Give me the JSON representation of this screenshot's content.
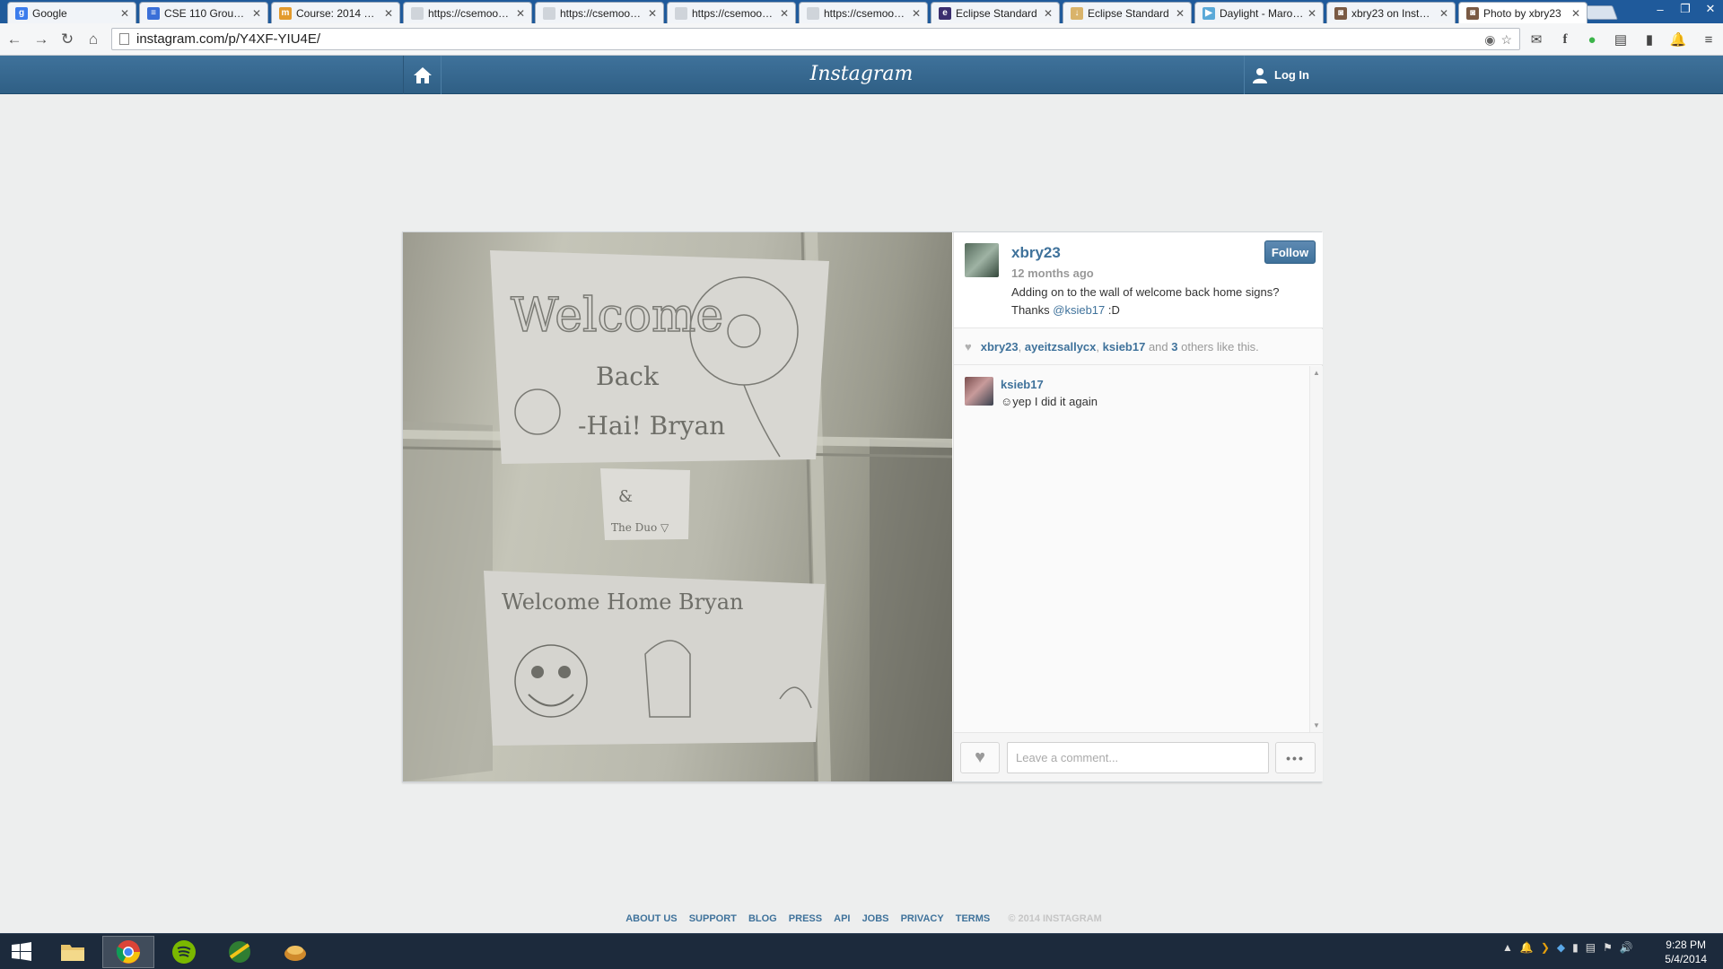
{
  "browser": {
    "tabs": [
      {
        "title": "Google",
        "icon": "google-icon",
        "color": "#3b7cec",
        "glyph": "g"
      },
      {
        "title": "CSE 110 Group 10",
        "icon": "docs-icon",
        "color": "#3a6fd8",
        "glyph": "≡"
      },
      {
        "title": "Course: 2014 Spring",
        "icon": "moodle-icon",
        "color": "#e39a2c",
        "glyph": "m"
      },
      {
        "title": "https://csemoodle",
        "icon": "page-icon",
        "color": "#cfd4da",
        "glyph": ""
      },
      {
        "title": "https://csemoodle",
        "icon": "page-icon",
        "color": "#cfd4da",
        "glyph": ""
      },
      {
        "title": "https://csemoodle",
        "icon": "page-icon",
        "color": "#cfd4da",
        "glyph": ""
      },
      {
        "title": "https://csemoodle",
        "icon": "page-icon",
        "color": "#cfd4da",
        "glyph": ""
      },
      {
        "title": "Eclipse Standard",
        "icon": "eclipse-icon",
        "color": "#3b2e6e",
        "glyph": "e"
      },
      {
        "title": "Eclipse Standard",
        "icon": "eclipse-download-icon",
        "color": "#d9b36a",
        "glyph": "↓"
      },
      {
        "title": "Daylight - Maroon 5",
        "icon": "play-store-icon",
        "color": "#5aa9d8",
        "glyph": "▶"
      },
      {
        "title": "xbry23 on Instagram",
        "icon": "instagram-icon",
        "color": "#7a5a44",
        "glyph": "◙"
      },
      {
        "title": "Photo by xbry23",
        "icon": "instagram-icon",
        "color": "#7a5a44",
        "glyph": "◙",
        "active": true
      }
    ],
    "url": "instagram.com/p/Y4XF-YIU4E/"
  },
  "header": {
    "logo": "Instagram",
    "login_label": "Log In"
  },
  "post": {
    "owner": {
      "username": "xbry23",
      "time_ago": "12 months ago",
      "caption_text": "Adding on to the wall of welcome back home signs? Thanks ",
      "caption_mention": "@ksieb17",
      "caption_end": " :D",
      "follow_label": "Follow"
    },
    "likes": {
      "likers": [
        "xbry23",
        "ayeitzsallycx",
        "ksieb17"
      ],
      "and_text": " and ",
      "others_count": "3",
      "suffix": " others like this."
    },
    "comments": [
      {
        "user": "ksieb17",
        "text": "☺yep I did it again"
      }
    ],
    "comment_placeholder": "Leave a comment...",
    "more_label": "•••"
  },
  "footer": {
    "links": [
      "ABOUT US",
      "SUPPORT",
      "BLOG",
      "PRESS",
      "API",
      "JOBS",
      "PRIVACY",
      "TERMS"
    ],
    "copyright": "© 2014 INSTAGRAM"
  },
  "taskbar": {
    "time": "9:28 PM",
    "date": "5/4/2014"
  },
  "colors": {
    "instagram_blue": "#3f729b",
    "page_background": "#edeeee",
    "taskbar": "#1c2a3c"
  }
}
